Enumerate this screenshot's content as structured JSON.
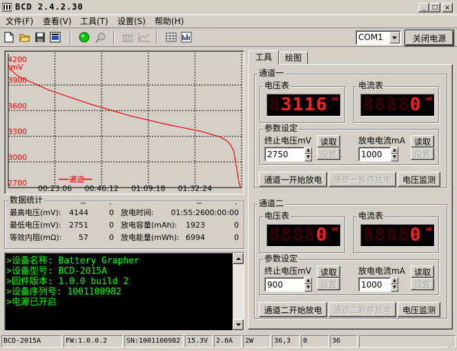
{
  "window": {
    "title": "BCD 2.4.2.30",
    "controls": [
      "_",
      "□",
      "×"
    ]
  },
  "menu": [
    "文件(F)",
    "查看(V)",
    "工具(T)",
    "设置(S)",
    "帮助(H)"
  ],
  "toolbar": {
    "port": "COM1",
    "power_button": "关闭电源"
  },
  "tabs": [
    "工具",
    "绘图"
  ],
  "chart_data": {
    "type": "line",
    "y_ticks": [
      "4200",
      "3900",
      "3600",
      "3300",
      "3000",
      "2700"
    ],
    "x_ticks": [
      "00:23:06",
      "00:46:12",
      "01:09:18",
      "01:32:24"
    ],
    "ylabel": "mV",
    "legend": "通道一",
    "ylim": [
      2700,
      4200
    ],
    "xlim_seconds": [
      0,
      6930
    ],
    "line_color": "#ff0000",
    "background": "#d4d0c8",
    "grid": "dashed",
    "series": [
      {
        "name": "通道一",
        "x": [
          0,
          60,
          300,
          1200,
          2400,
          3600,
          4800,
          5700,
          6300,
          6500,
          6600,
          6700,
          6750,
          6800,
          6850,
          6900
        ],
        "y": [
          4144,
          4080,
          4000,
          3840,
          3680,
          3540,
          3430,
          3360,
          3290,
          3245,
          3200,
          3120,
          3000,
          2880,
          2760,
          2700
        ]
      }
    ]
  },
  "stats": {
    "title": "数据统计",
    "rows": [
      {
        "label": "最高电压(mV):",
        "v1": "4144",
        "v2": "0",
        "label2": "放电时间:",
        "v3": "01:55:26",
        "v4": "00:00:00"
      },
      {
        "label": "最低电压(mV):",
        "v1": "2751",
        "v2": "0",
        "label2": "放电容量(mAh):",
        "v3": "1923",
        "v4": "0"
      },
      {
        "label": "等效内阻(mΩ):",
        "v1": "57",
        "v2": "0",
        "label2": "放电能量(mWh):",
        "v3": "6994",
        "v4": "0"
      }
    ]
  },
  "console": {
    "lines": [
      ">设备名称: Battery Grapher",
      ">设备型号: BCD-2015A",
      ">固件版本: 1.0.0 build 2",
      ">设备序列号: 1001100982",
      ">电源已开启"
    ]
  },
  "ch1": {
    "title": "通道一",
    "voltage_title": "电压表",
    "current_title": "电流表",
    "voltage_value": "3116",
    "voltage_unit": "mV",
    "current_value": "0",
    "current_unit": "mA",
    "params_title": "参数设定",
    "end_v_label": "终止电压mV",
    "end_v_value": "2750",
    "current_label": "放电电流mA",
    "current_input": "1000",
    "read": "读取",
    "set": "设置",
    "start": "通道一开始放电",
    "pause": "通道一暂停放电",
    "monitor": "电压监测"
  },
  "ch2": {
    "title": "通道二",
    "voltage_title": "电压表",
    "current_title": "电流表",
    "voltage_value": "0",
    "voltage_unit": "mV",
    "current_value": "0",
    "current_unit": "mA",
    "params_title": "参数设定",
    "end_v_label": "终止电压mV",
    "end_v_value": "900",
    "current_label": "放电电流mA",
    "current_input": "1000",
    "read": "读取",
    "set": "设置",
    "start": "通道二开始放电",
    "pause": "通道二暂停放电",
    "monitor": "电压监测"
  },
  "statusbar": [
    "BCD-2015A",
    "FW:1.0.0.2",
    "SN:1001100982",
    "15.3V",
    "2.0A",
    "2W",
    "36,3",
    "0",
    "36"
  ]
}
